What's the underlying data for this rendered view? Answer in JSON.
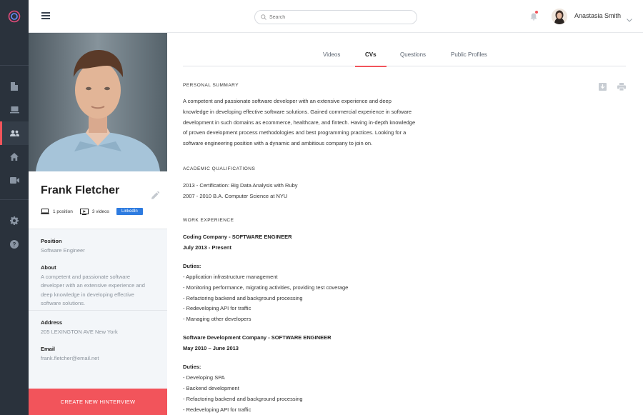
{
  "header": {
    "search_placeholder": "Search",
    "user_name": "Anastasia Smith"
  },
  "sidebar": {
    "items": [
      {
        "icon": "document-icon"
      },
      {
        "icon": "laptop-icon"
      },
      {
        "icon": "people-icon",
        "active": true
      },
      {
        "icon": "home-icon"
      },
      {
        "icon": "video-camera-icon"
      },
      {
        "icon": "gear-icon"
      },
      {
        "icon": "help-icon"
      }
    ]
  },
  "profile": {
    "name": "Frank Fletcher",
    "positions_label": "1 position",
    "videos_label": "3 videos",
    "linkedin_label": "LinkedIn",
    "position_heading": "Position",
    "position_value": "Software Engineer",
    "about_heading": "About",
    "about_lines": [
      "A competent and passionate software",
      "developer with an extensive experience and",
      "deep knowledge in developing effective",
      "software solutions."
    ],
    "address_heading": "Address",
    "address_value": "205 LEXINGTON AVE New York",
    "email_heading": "Email",
    "email_value": "frank.fletcher@email.net",
    "cta_label": "CREATE NEW HINTERVIEW"
  },
  "tabs": [
    "Videos",
    "CVs",
    "Questions",
    "Public Profiles"
  ],
  "active_tab": "CVs",
  "cv": {
    "summary_title": "PERSONAL SUMMARY",
    "summary_lines": [
      "A competent and passionate software developer with an extensive experience and deep",
      "knowledge in developing effective software solutions. Gained commercial experience in software",
      "development in such domains as ecommerce, healthcare, and fintech. Having in-depth knowledge",
      "of proven development process methodologies and best programming practices. Looking for a",
      "software engineering position with a dynamic and ambitious company to join on."
    ],
    "academic_title": "ACADEMIC QUALIFICATIONS",
    "academic_lines": [
      "2013 - Certification: Big Data Analysis with Ruby",
      "2007 - 2010 B.A. Computer Science at NYU"
    ],
    "work_title": "WORK EXPERIENCE",
    "jobs": [
      {
        "title": "Coding Company - SOFTWARE ENGINEER",
        "period": "July 2013 - Present",
        "duties_label": "Duties:",
        "duties": [
          "- Application infrastructure management",
          "- Monitoring performance, migrating activities, providing test coverage",
          "- Refactoring backend and background processing",
          "- Redeveloping API for traffic",
          "- Managing other developers"
        ]
      },
      {
        "title": "Software Development Company - SOFTWARE ENGINEER",
        "period": "May 2010 – June 2013",
        "duties_label": "Duties:",
        "duties": [
          "- Developing SPA",
          "- Backend development",
          "- Refactoring backend and background processing",
          "- Redeveloping API for traffic"
        ]
      }
    ]
  },
  "colors": {
    "accent": "#f2545b",
    "rail": "#2a323c",
    "linkedin": "#2d7be0"
  }
}
